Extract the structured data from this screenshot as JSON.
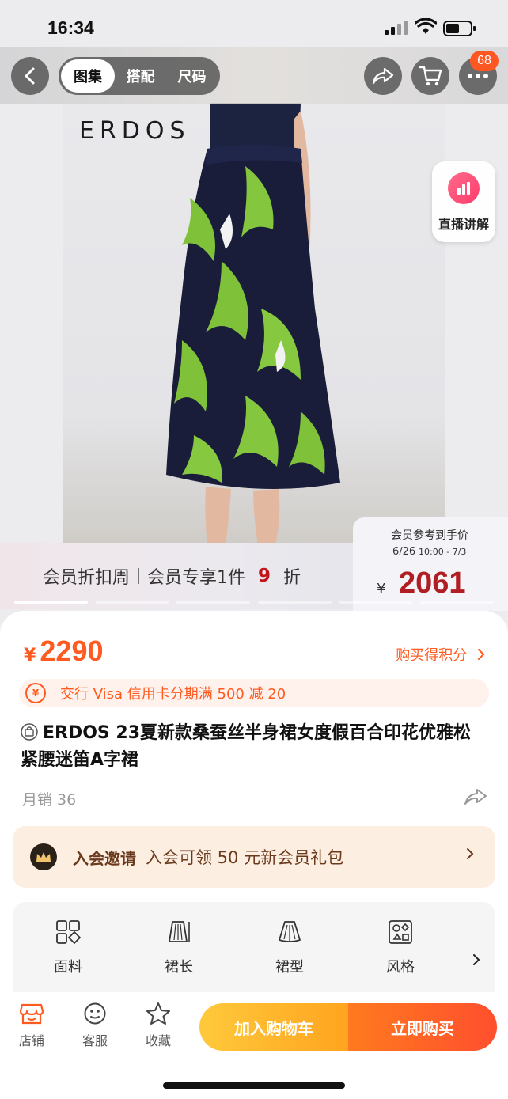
{
  "status_bar": {
    "time": "16:34"
  },
  "nav": {
    "tabs": [
      {
        "label": "图集",
        "active": true
      },
      {
        "label": "搭配",
        "active": false
      },
      {
        "label": "尺码",
        "active": false
      }
    ],
    "cart_badge": "68"
  },
  "hero": {
    "brand": "ERDOS",
    "live_label": "直播讲解",
    "image_count": 6,
    "active_image": 1
  },
  "promo": {
    "label_a": "会员折扣周",
    "label_b": "会员专享1件",
    "discount": "9",
    "discount_suffix": "折",
    "member_price_title": "会员参考到手价",
    "member_price_date_a": "6/26",
    "member_price_date_b": "10:00 - 7/3",
    "member_price_yen": "¥",
    "member_price_value": "2061"
  },
  "product": {
    "price_yen": "¥",
    "price": "2290",
    "points_link": "购买得积分",
    "credit_promo": "交行 Visa 信用卡分期满 500 减 20",
    "title": "ERDOS 23夏新款桑蚕丝半身裙女度假百合印花优雅松紧腰迷笛A字裙",
    "monthly_sales": "月销 36"
  },
  "vip": {
    "tag": "入会邀请",
    "text": "入会可领 50 元新会员礼包"
  },
  "attributes": [
    {
      "label": "面料",
      "value": "",
      "icon": "fabric-icon"
    },
    {
      "label": "裙长",
      "value": "",
      "icon": "skirt-length-icon"
    },
    {
      "label": "裙型",
      "value": "",
      "icon": "skirt-shape-icon"
    },
    {
      "label": "风格",
      "value": "",
      "icon": "style-icon"
    }
  ],
  "bottom": {
    "shop": "店铺",
    "service": "客服",
    "favorite": "收藏",
    "add_to_cart": "加入购物车",
    "buy_now": "立即购买"
  },
  "colors": {
    "accent": "#ff5a1f",
    "member_price": "#b01d22",
    "vip_text": "#6b3a1d"
  }
}
